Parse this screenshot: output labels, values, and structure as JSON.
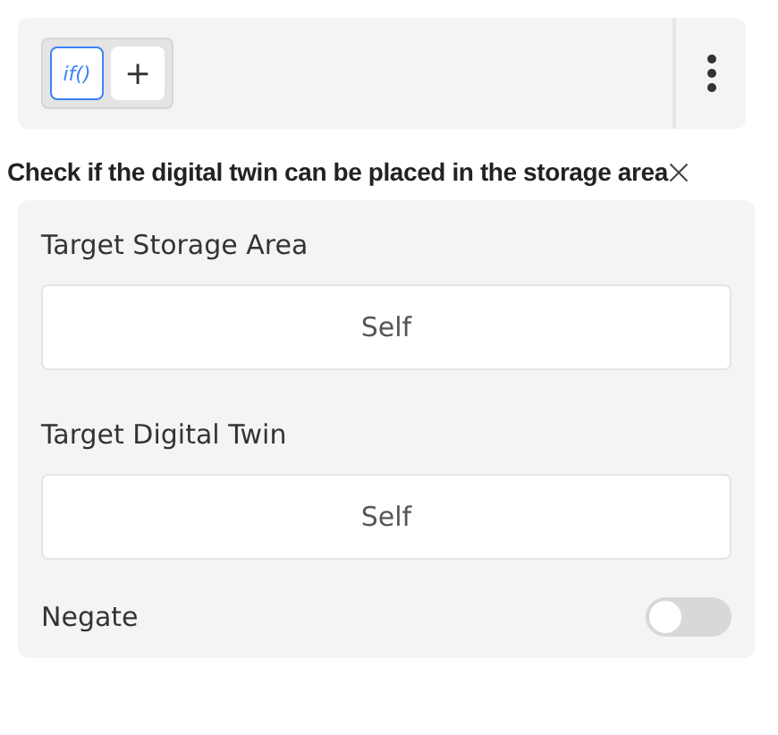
{
  "toolbar": {
    "tools": [
      {
        "label": "if()",
        "selected": true
      },
      {
        "label": "+",
        "selected": false
      }
    ]
  },
  "title": "Check if the digital twin can be placed in the storage area",
  "fields": [
    {
      "label": "Target Storage Area",
      "value": "Self"
    },
    {
      "label": "Target Digital Twin",
      "value": "Self"
    }
  ],
  "negate": {
    "label": "Negate",
    "on": false
  }
}
